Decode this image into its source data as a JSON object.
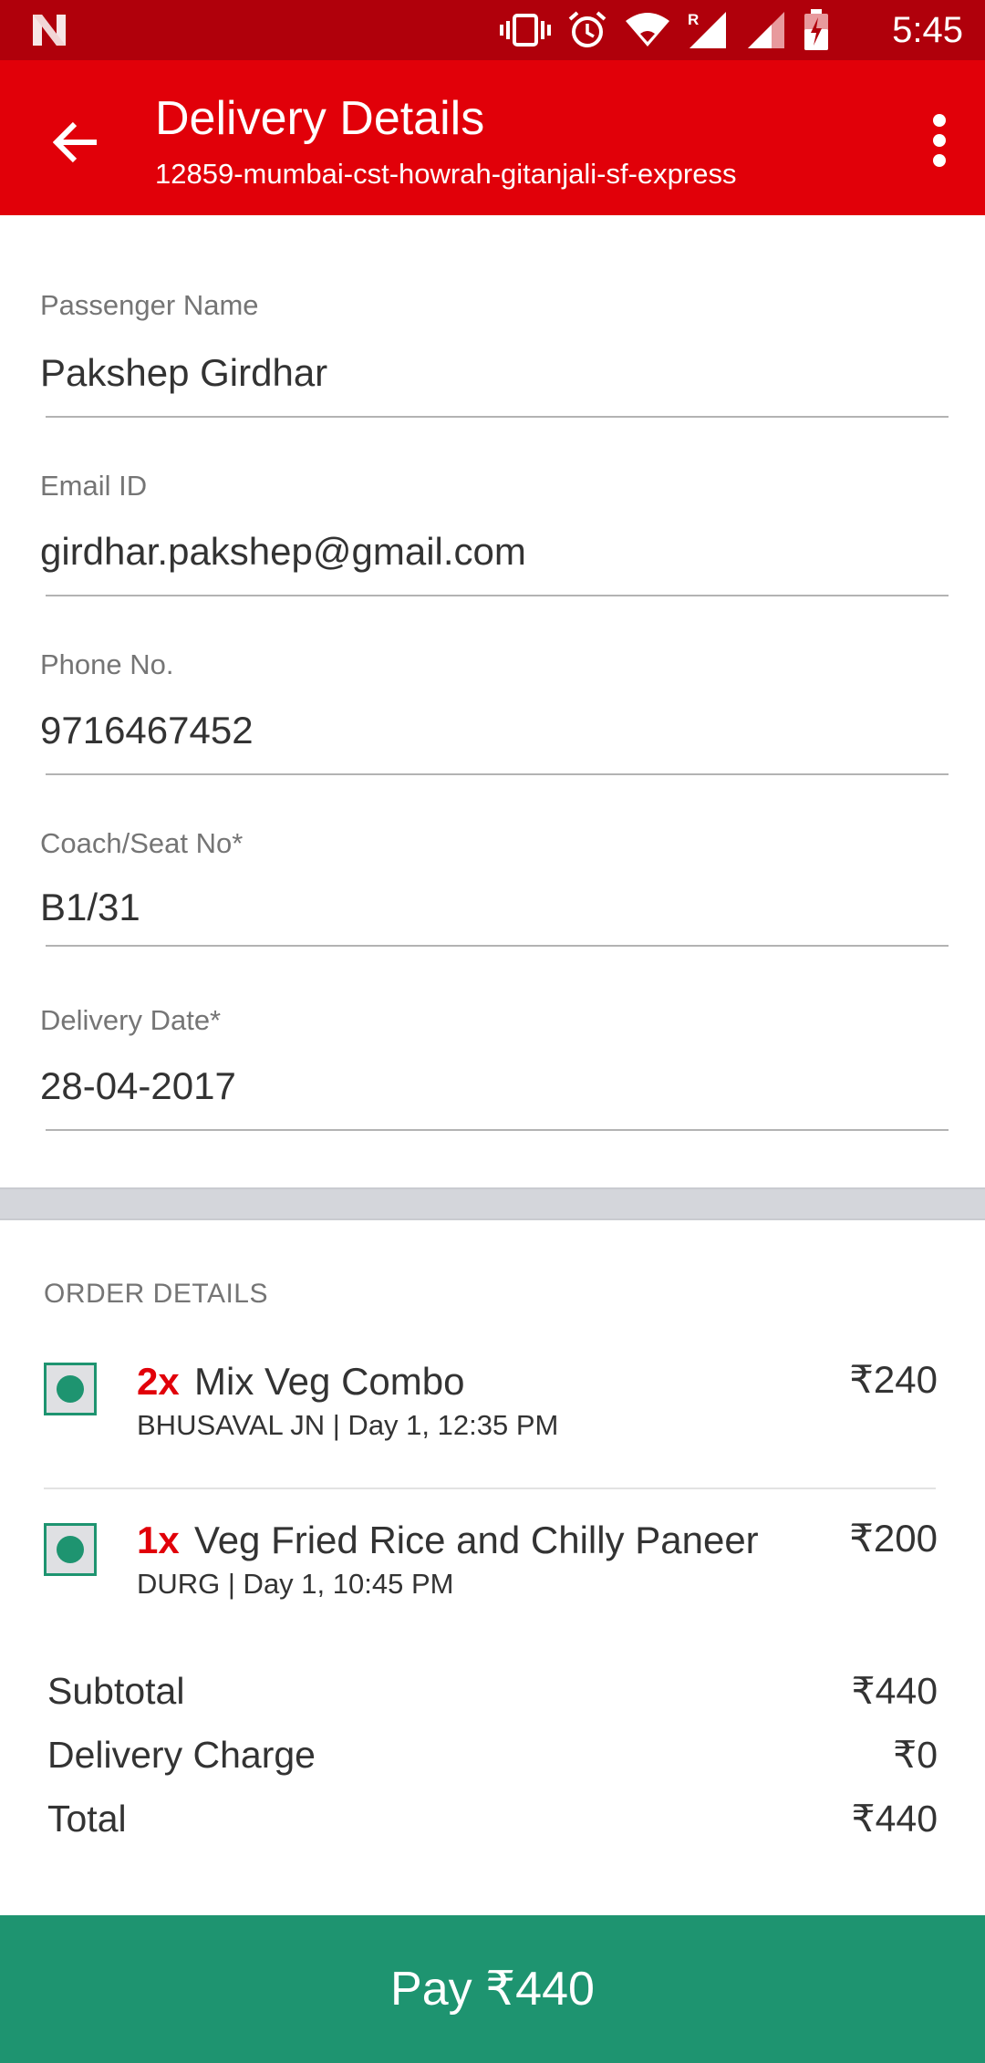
{
  "status_bar": {
    "time": "5:45",
    "icons": [
      "notification-n-icon",
      "vibrate-icon",
      "alarm-icon",
      "wifi-icon",
      "signal-roaming-icon",
      "signal-icon",
      "battery-charging-icon"
    ],
    "roaming_indicator": "R"
  },
  "app_bar": {
    "title": "Delivery Details",
    "subtitle": "12859-mumbai-cst-howrah-gitanjali-sf-express",
    "back_icon": "arrow-left-icon",
    "menu_icon": "more-vert-icon"
  },
  "form": {
    "passenger_name": {
      "label": "Passenger Name",
      "value": "Pakshep Girdhar"
    },
    "email": {
      "label": "Email ID",
      "value": "girdhar.pakshep@gmail.com"
    },
    "phone": {
      "label": "Phone No.",
      "value": "9716467452"
    },
    "coach_seat": {
      "label": "Coach/Seat No*",
      "value": "B1/31"
    },
    "delivery_date": {
      "label": "Delivery Date*",
      "value": "28-04-2017"
    }
  },
  "order": {
    "heading": "ORDER DETAILS",
    "items": [
      {
        "qty": "2x",
        "name": "Mix Veg Combo",
        "meta": "BHUSAVAL JN | Day 1, 12:35 PM",
        "price": "₹240",
        "veg_icon": "veg-indicator-icon"
      },
      {
        "qty": "1x",
        "name": "Veg Fried Rice and Chilly Paneer",
        "meta": "DURG | Day 1, 10:45 PM",
        "price": "₹200",
        "veg_icon": "veg-indicator-icon"
      }
    ],
    "subtotal": {
      "label": "Subtotal",
      "value": "₹440"
    },
    "delivery_charge": {
      "label": "Delivery Charge",
      "value": "₹0"
    },
    "total": {
      "label": "Total",
      "value": "₹440"
    }
  },
  "pay_button": {
    "label": "Pay ₹440"
  },
  "colors": {
    "status_bar": "#b0000b",
    "app_bar": "#e10009",
    "accent_red": "#e10009",
    "pay_green": "#1e9470",
    "separator": "#d4d6db"
  }
}
